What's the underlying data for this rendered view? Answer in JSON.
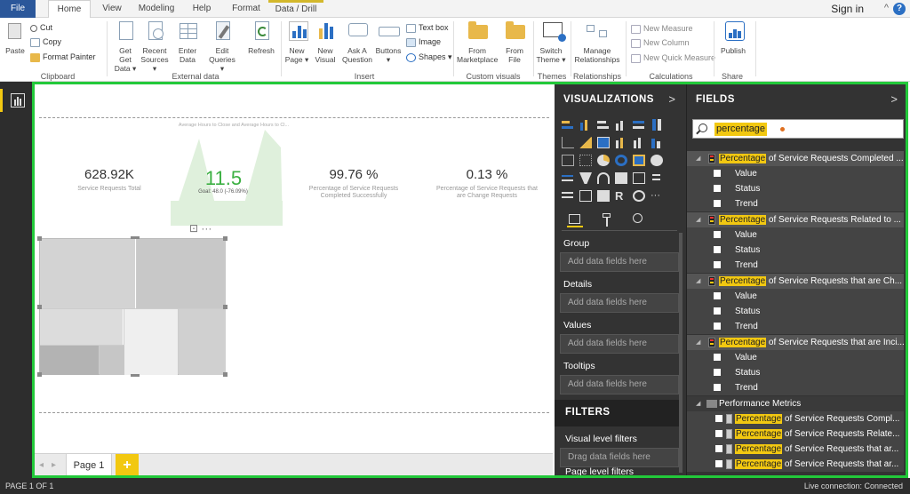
{
  "tabs": [
    "File",
    "Home",
    "View",
    "Modeling",
    "Help",
    "Format",
    "Data / Drill"
  ],
  "signin": "Sign in",
  "ribbon": {
    "clipboard": {
      "paste": "Paste",
      "cut": "Cut",
      "copy": "Copy",
      "format_painter": "Format Painter",
      "label": "Clipboard"
    },
    "external": {
      "get_data": "Get Data ▾",
      "get_data_l1": "Get",
      "recent_l1": "Recent",
      "recent_l2": "Sources ▾",
      "enter_l1": "Enter",
      "enter_l2": "Data",
      "edit_l1": "Edit",
      "edit_l2": "Queries ▾",
      "refresh": "Refresh",
      "label": "External data"
    },
    "insert": {
      "new_page_l1": "New",
      "new_page_l2": "Page ▾",
      "new_visual_l1": "New",
      "new_visual_l2": "Visual",
      "ask_l1": "Ask A",
      "ask_l2": "Question",
      "buttons": "Buttons",
      "buttons_l2": "▾",
      "textbox": "Text box",
      "image": "Image",
      "shapes": "Shapes ▾",
      "label": "Insert"
    },
    "custom": {
      "from_marketplace_l1": "From",
      "from_marketplace_l2": "Marketplace",
      "from_file_l1": "From",
      "from_file_l2": "File",
      "label": "Custom visuals"
    },
    "themes": {
      "switch_l1": "Switch",
      "switch_l2": "Theme ▾",
      "label": "Themes"
    },
    "relationships": {
      "manage_l1": "Manage",
      "manage_l2": "Relationships",
      "label": "Relationships"
    },
    "calculations": {
      "new_measure": "New Measure",
      "new_column": "New Column",
      "new_quick_measure": "New Quick Measure",
      "label": "Calculations"
    },
    "share": {
      "publish": "Publish",
      "label": "Share"
    }
  },
  "canvas": {
    "kpis": [
      {
        "value": "628.92K",
        "label": "Service Requests Total"
      },
      {
        "value": "99.76 %",
        "label": "Percentage of Service Requests Completed Successfully"
      },
      {
        "value": "0.13 %",
        "label": "Percentage of Service Requests that are Change Requests"
      }
    ],
    "gauge": {
      "title": "Average Hours to Close and Average Hours to Cl...",
      "value": "11.5",
      "goal": "Goal: 48.0 (-76.09%)"
    },
    "visual_header": "⊡  ···",
    "page_tab": "Page 1",
    "add_page": "+"
  },
  "visualizations": {
    "title": "VISUALIZATIONS",
    "arrow": ">",
    "wells": [
      {
        "label": "Group",
        "placeholder": "Add data fields here"
      },
      {
        "label": "Details",
        "placeholder": "Add data fields here"
      },
      {
        "label": "Values",
        "placeholder": "Add data fields here"
      },
      {
        "label": "Tooltips",
        "placeholder": "Add data fields here"
      }
    ],
    "filters": {
      "title": "FILTERS",
      "visual_level": "Visual level filters",
      "placeholder": "Drag data fields here",
      "page_level": "Page level filters"
    }
  },
  "fields": {
    "title": "FIELDS",
    "arrow": ">",
    "search_value": "percentage",
    "highlight": "Percentage",
    "tables": [
      {
        "rest": " of Service Requests Completed ...",
        "items": [
          "Value",
          "Status",
          "Trend"
        ]
      },
      {
        "rest": " of Service Requests Related to ...",
        "items": [
          "Value",
          "Status",
          "Trend"
        ]
      },
      {
        "rest": " of Service Requests that are Ch...",
        "items": [
          "Value",
          "Status",
          "Trend"
        ]
      },
      {
        "rest": " of Service Requests that are Inci...",
        "items": [
          "Value",
          "Status",
          "Trend"
        ]
      }
    ],
    "folder": "Performance Metrics",
    "folder_items": [
      " of Service Requests Compl...",
      " of Service Requests Relate...",
      " of Service Requests that ar...",
      " of Service Requests that ar..."
    ]
  },
  "status": {
    "left": "PAGE 1 OF 1",
    "right": "Live connection: Connected"
  }
}
